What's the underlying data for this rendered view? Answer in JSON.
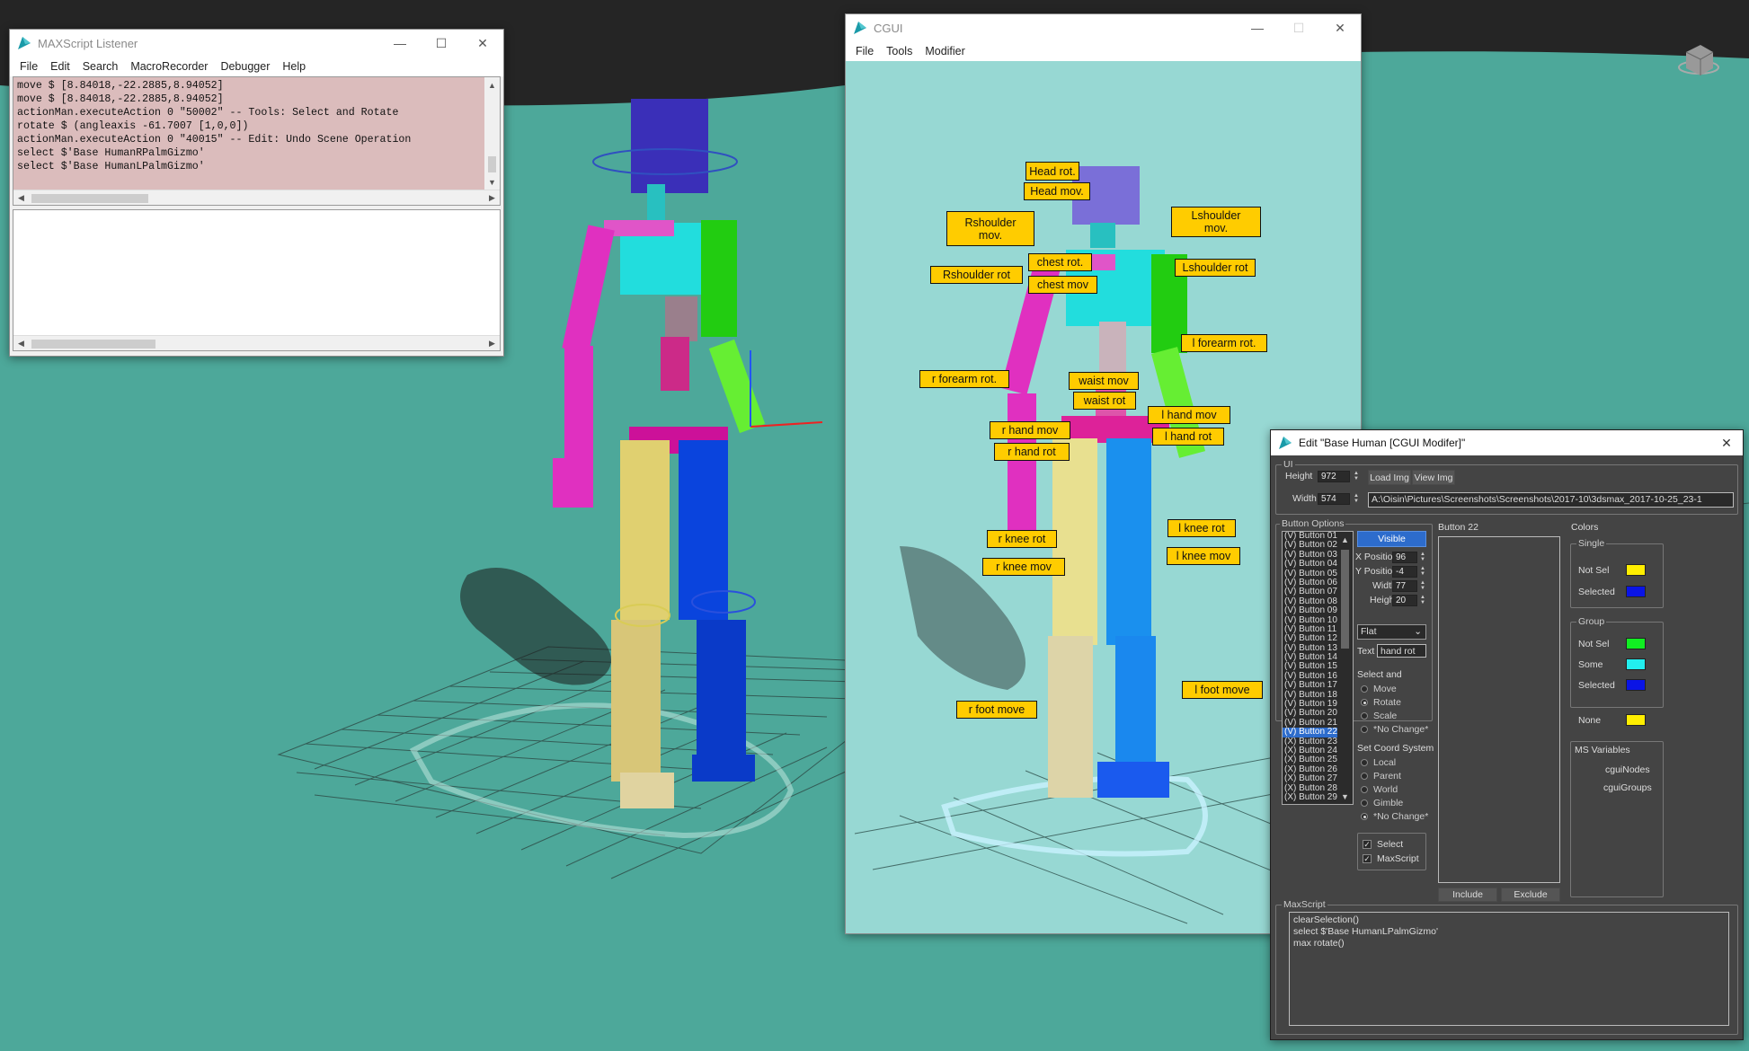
{
  "viewport": {
    "background_color": "#4da89a",
    "dark_band_color": "#252525"
  },
  "listener": {
    "title": "MAXScript Listener",
    "menu": [
      "File",
      "Edit",
      "Search",
      "MacroRecorder",
      "Debugger",
      "Help"
    ],
    "lines": [
      "move $ [8.84018,-22.2885,8.94052]",
      "move $ [8.84018,-22.2885,8.94052]",
      "actionMan.executeAction 0 \"50002\"  -- Tools: Select and Rotate",
      "rotate $ (angleaxis -61.7007 [1,0,0])",
      "actionMan.executeAction 0 \"40015\"  -- Edit: Undo Scene Operation",
      "select $'Base HumanRPalmGizmo'",
      "select $'Base HumanLPalmGizmo'"
    ],
    "output_bg": "#dbbcbc"
  },
  "cgui": {
    "title": "CGUI",
    "menu": [
      "File",
      "Tools",
      "Modifier"
    ],
    "bg": "#97d8d3",
    "buttons": [
      {
        "label": "Head rot."
      },
      {
        "label": "Head mov."
      },
      {
        "label": "Rshoulder\nmov."
      },
      {
        "label": "Lshoulder\nmov."
      },
      {
        "label": "chest rot."
      },
      {
        "label": "Rshoulder rot"
      },
      {
        "label": "chest mov"
      },
      {
        "label": "Lshoulder rot"
      },
      {
        "label": "l forearm rot."
      },
      {
        "label": "r forearm rot."
      },
      {
        "label": "waist mov"
      },
      {
        "label": "waist rot"
      },
      {
        "label": "l hand mov"
      },
      {
        "label": "r hand mov"
      },
      {
        "label": "l hand rot"
      },
      {
        "label": "r hand rot"
      },
      {
        "label": "l knee rot"
      },
      {
        "label": "r knee rot"
      },
      {
        "label": "l knee mov"
      },
      {
        "label": "r knee mov"
      },
      {
        "label": "l foot move"
      },
      {
        "label": "r foot move"
      }
    ]
  },
  "edit": {
    "title": "Edit \"Base Human [CGUI Modifer]\"",
    "ui_group": "UI",
    "height_label": "Height",
    "height_value": "972",
    "width_label": "Width",
    "width_value": "574",
    "load_img": "Load Img",
    "view_img": "View Img",
    "path": "A:\\Oisin\\Pictures\\Screenshots\\Screenshots\\2017-10\\3dsmax_2017-10-25_23-1",
    "button_options_label": "Button Options",
    "button_list": [
      "(V) Button 01",
      "(V) Button 02",
      "(V) Button 03",
      "(V) Button 04",
      "(V) Button 05",
      "(V) Button 06",
      "(V) Button 07",
      "(V) Button 08",
      "(V) Button 09",
      "(V) Button 10",
      "(V) Button 11",
      "(V) Button 12",
      "(V) Button 13",
      "(V) Button 14",
      "(V) Button 15",
      "(V) Button 16",
      "(V) Button 17",
      "(V) Button 18",
      "(V) Button 19",
      "(V) Button 20",
      "(V) Button 21",
      "(V) Button 22",
      "(X) Button 23",
      "(X) Button 24",
      "(X) Button 25",
      "(X) Button 26",
      "(X) Button 27",
      "(X) Button 28",
      "(X) Button 29"
    ],
    "selected_index": 21,
    "visible_label": "Visible",
    "xpos_label": "X Position",
    "xpos_value": "96",
    "ypos_label": "Y Position",
    "ypos_value": "-4",
    "bwidth_label": "Width",
    "bwidth_value": "77",
    "bheight_label": "Height",
    "bheight_value": "20",
    "style_value": "Flat",
    "text_label": "Text",
    "text_value": "hand rot",
    "select_and_label": "Select and",
    "select_and_opts": [
      "Move",
      "Rotate",
      "Scale",
      "*No Change*"
    ],
    "select_and_on": 1,
    "coord_label": "Set Coord System",
    "coord_opts": [
      "Local",
      "Parent",
      "World",
      "Gimble",
      "*No Change*"
    ],
    "coord_on": 4,
    "check_select": "Select",
    "check_maxscript": "MaxScript",
    "button22_label": "Button 22",
    "include": "Include",
    "exclude": "Exclude",
    "colors_label": "Colors",
    "single_label": "Single",
    "group_label": "Group",
    "not_sel": "Not Sel",
    "selected": "Selected",
    "some": "Some",
    "none": "None",
    "color_single_notsel": "#ffee00",
    "color_single_sel": "#0a14e6",
    "color_group_notsel": "#11ee22",
    "color_group_some": "#22eeee",
    "color_group_sel": "#0a14e6",
    "color_none": "#ffee00",
    "ms_vars_label": "MS Variables",
    "ms_vars": [
      "cguiNodes",
      "cguiGroups"
    ],
    "maxscript_label": "MaxScript",
    "maxscript_lines": [
      "clearSelection()",
      "select $'Base HumanLPalmGizmo'",
      "max rotate()"
    ]
  }
}
